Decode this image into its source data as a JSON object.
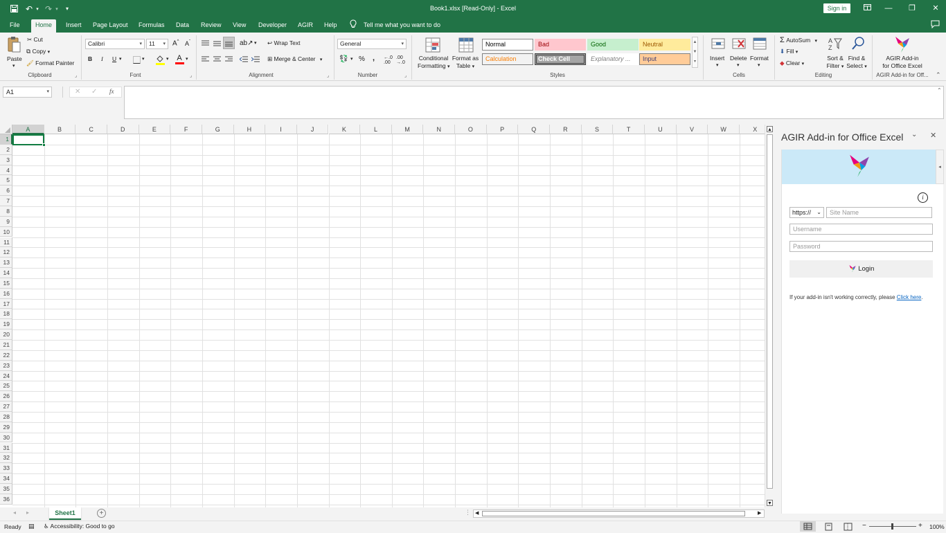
{
  "window": {
    "title": "Book1.xlsx  [Read-Only]  -  Excel",
    "sign_in": "Sign in"
  },
  "menu": {
    "tabs": [
      "File",
      "Home",
      "Insert",
      "Page Layout",
      "Formulas",
      "Data",
      "Review",
      "View",
      "Developer",
      "AGIR",
      "Help"
    ],
    "tell_me": "Tell me what you want to do",
    "active_tab": "Home"
  },
  "ribbon": {
    "clipboard": {
      "paste": "Paste",
      "cut": "Cut",
      "copy": "Copy",
      "format_painter": "Format Painter",
      "label": "Clipboard"
    },
    "font": {
      "name": "Calibri",
      "size": "11",
      "bold": "B",
      "italic": "I",
      "underline": "U",
      "grow": "A",
      "shrink": "A",
      "font_color": "A",
      "label": "Font"
    },
    "alignment": {
      "wrap_text": "Wrap Text",
      "merge_center": "Merge & Center",
      "label": "Alignment"
    },
    "number": {
      "format": "General",
      "percent": "%",
      "comma": ",",
      "label": "Number"
    },
    "styles": {
      "conditional": [
        "Conditional",
        "Formatting"
      ],
      "format_table": [
        "Format as",
        "Table"
      ],
      "cells": [
        {
          "name": "Normal",
          "bg": "#ffffff",
          "fg": "#000000",
          "border": "#8a8a8a"
        },
        {
          "name": "Bad",
          "bg": "#ffc7ce",
          "fg": "#9c0006",
          "border": "#ffc7ce"
        },
        {
          "name": "Good",
          "bg": "#c6efce",
          "fg": "#006100",
          "border": "#c6efce"
        },
        {
          "name": "Neutral",
          "bg": "#ffeb9c",
          "fg": "#9c5700",
          "border": "#ffeb9c"
        },
        {
          "name": "Calculation",
          "bg": "#f2f2f2",
          "fg": "#fa7d00",
          "border": "#7f7f7f"
        },
        {
          "name": "Check Cell",
          "bg": "#a5a5a5",
          "fg": "#ffffff",
          "border": "#3f3f3f"
        },
        {
          "name": "Explanatory ...",
          "bg": "#ffffff",
          "fg": "#7f7f7f",
          "border": "#ffffff"
        },
        {
          "name": "Input",
          "bg": "#ffcc99",
          "fg": "#3f3f76",
          "border": "#7f7f7f"
        }
      ],
      "label": "Styles"
    },
    "cells_group": {
      "insert": "Insert",
      "delete": "Delete",
      "format": "Format",
      "label": "Cells"
    },
    "editing": {
      "autosum": "AutoSum",
      "fill": "Fill",
      "clear": "Clear",
      "sort_filter": [
        "Sort &",
        "Filter"
      ],
      "find_select": [
        "Find &",
        "Select"
      ],
      "label": "Editing"
    },
    "agir": {
      "button": [
        "AGIR Add-in",
        "for Office Excel"
      ],
      "label": "AGIR Add-in for Off..."
    }
  },
  "formula_bar": {
    "name_box": "A1",
    "fx": "fx",
    "value": ""
  },
  "grid": {
    "columns": [
      "A",
      "B",
      "C",
      "D",
      "E",
      "F",
      "G",
      "H",
      "I",
      "J",
      "K",
      "L",
      "M",
      "N",
      "O",
      "P",
      "Q",
      "R",
      "S",
      "T",
      "U",
      "V",
      "W",
      "X"
    ],
    "rows": [
      "1",
      "2",
      "3",
      "4",
      "5",
      "6",
      "7",
      "8",
      "9",
      "10",
      "11",
      "12",
      "13",
      "14",
      "15",
      "16",
      "17",
      "18",
      "19",
      "20",
      "21",
      "22",
      "23",
      "24",
      "25",
      "26",
      "27",
      "28",
      "29",
      "30",
      "31",
      "32",
      "33",
      "34",
      "35",
      "36"
    ],
    "selected_cell": "A1"
  },
  "task_pane": {
    "title": "AGIR Add-in for Office Excel",
    "protocol": "https://",
    "site_placeholder": "Site Name",
    "username_placeholder": "Username",
    "password_placeholder": "Password",
    "login": "Login",
    "help_text": "If your add-in isn't working correctly, please ",
    "help_link": "Click here",
    "help_end": "."
  },
  "sheets": {
    "tabs": [
      "Sheet1"
    ]
  },
  "status": {
    "ready": "Ready",
    "accessibility": "Accessibility: Good to go",
    "zoom": "100%"
  },
  "colors": {
    "excel_green": "#217346",
    "selection": "#107c41"
  }
}
